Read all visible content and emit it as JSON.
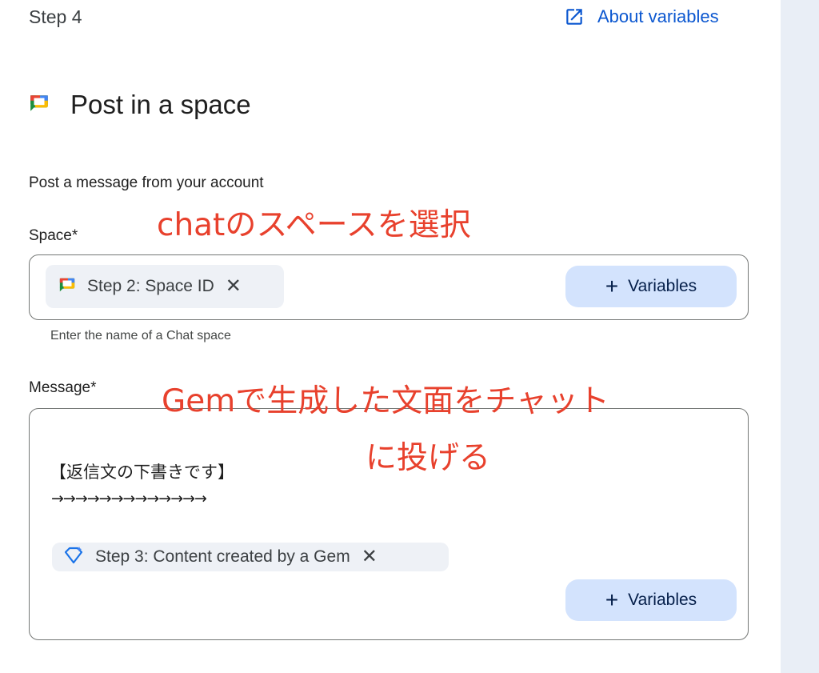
{
  "header": {
    "step_label": "Step 4",
    "about_link": "About variables",
    "about_icon": "open-in-new-icon"
  },
  "action": {
    "title": "Post in a space",
    "icon": "google-chat-icon",
    "description": "Post a message from your account"
  },
  "space_field": {
    "label": "Space*",
    "chip_label": "Step 2: Space ID",
    "chip_icon": "google-chat-icon",
    "helper": "Enter the name of a Chat space",
    "variables_button": "Variables"
  },
  "message_field": {
    "label": "Message*",
    "lines": [
      "【返信文の下書きです】",
      "→→→→→→→→→→→→→"
    ],
    "chip_label": "Step 3: Content created by a Gem",
    "chip_icon": "gem-sparkle-icon",
    "variables_button": "Variables"
  },
  "annotations": {
    "space_note": "chatのスペースを選択",
    "message_note_line1": "Gemで生成した文面をチャット",
    "message_note_line2": "に投げる"
  },
  "colors": {
    "link": "#0b57d0",
    "variables_button_bg": "#d3e3fd",
    "chip_bg": "#eef1f6",
    "annotation": "#e8412d",
    "right_rail": "#e9eef6"
  }
}
